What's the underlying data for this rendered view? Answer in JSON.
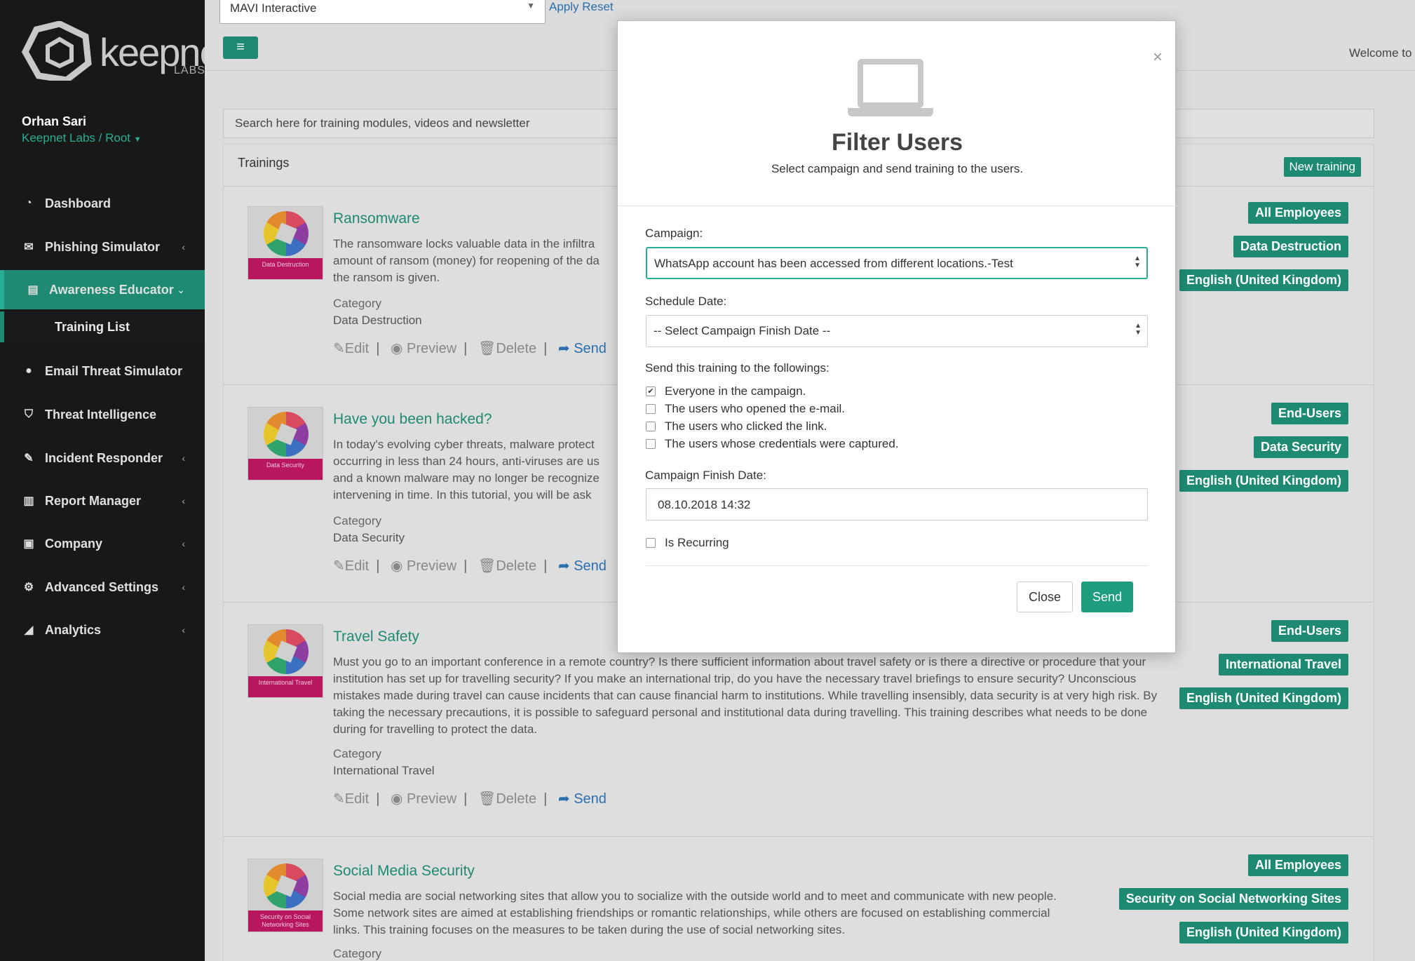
{
  "app": {
    "logo_text": "keepnet",
    "logo_sub": "LABS"
  },
  "topbar": {
    "company_select": "MAVI Interactive",
    "apply_reset": "Apply Reset",
    "welcome": "Welcome to"
  },
  "user": {
    "name": "Orhan Sari",
    "org": "Keepnet Labs / Root"
  },
  "nav": {
    "dashboard": "Dashboard",
    "phishing": "Phishing Simulator",
    "awareness": "Awareness Educator",
    "training_list": "Training List",
    "email_threat": "Email Threat Simulator",
    "threat_intel": "Threat Intelligence",
    "incident": "Incident Responder",
    "report": "Report Manager",
    "company": "Company",
    "advanced": "Advanced Settings",
    "analytics": "Analytics"
  },
  "search": {
    "placeholder": "Search here for training modules, videos and newsletter"
  },
  "trainings": {
    "title": "Trainings",
    "new_training": "New training",
    "category_label": "Category",
    "actions": {
      "edit": "Edit",
      "preview": "Preview",
      "delete": "Delete",
      "send": "Send"
    },
    "items": [
      {
        "title": "Ransomware",
        "thumb": "Data Destruction",
        "desc": "The ransomware locks valuable data in the infiltra\namount of ransom (money) for reopening of the da\nthe ransom is given.",
        "category": "Data Destruction",
        "tags": [
          "All Employees",
          "Data Destruction",
          "English (United Kingdom)"
        ]
      },
      {
        "title": "Have you been hacked?",
        "thumb": "Data Security",
        "desc": "In today's evolving cyber threats, malware protect\noccurring in less than 24 hours, anti-viruses are us\nand a known malware may no longer be recognize\nintervening in time. In this tutorial, you will be ask",
        "category": "Data Security",
        "tags": [
          "End-Users",
          "Data Security",
          "English (United Kingdom)"
        ]
      },
      {
        "title": "Travel Safety",
        "thumb": "International Travel",
        "desc": "Must you go to an important conference in a remote country? Is there sufficient information about travel safety or is there a directive or procedure that your institution has set up for travelling security? If you make an international trip, do you have the necessary travel briefings to ensure security? Unconscious mistakes made during travel can cause incidents that can cause financial harm to institutions. While travelling insensibly, data security is at very high risk. By taking the necessary precautions, it is possible to safeguard personal and institutional data during travelling. This training describes what needs to be done during for travelling to protect the data.",
        "category": "International Travel",
        "tags": [
          "End-Users",
          "International Travel",
          "English (United Kingdom)"
        ]
      },
      {
        "title": "Social Media Security",
        "thumb": "Security on Social Networking Sites",
        "desc": "Social media are social networking sites that allow you to socialize with the outside world and to meet and communicate with new people. Some network sites are aimed at establishing friendships or romantic relationships, while others are focused on establishing commercial links. This training focuses on the measures to be taken during the use of social networking sites.",
        "category": "",
        "tags": [
          "All Employees",
          "Security on Social Networking Sites",
          "English (United Kingdom)"
        ]
      }
    ]
  },
  "modal": {
    "close_x": "×",
    "title": "Filter Users",
    "subtitle": "Select campaign and send training to the users.",
    "campaign_label": "Campaign:",
    "campaign_value": "WhatsApp account has been accessed from different locations.-Test",
    "schedule_label": "Schedule Date:",
    "schedule_value": "-- Select Campaign Finish Date --",
    "send_to_label": "Send this training to the followings:",
    "options": [
      {
        "label": "Everyone in the campaign.",
        "checked": true
      },
      {
        "label": "The users who opened the e-mail.",
        "checked": false
      },
      {
        "label": "The users who clicked the link.",
        "checked": false
      },
      {
        "label": "The users whose credentials were captured.",
        "checked": false
      }
    ],
    "finish_label": "Campaign Finish Date:",
    "finish_value": "08.10.2018 14:32",
    "recurring_label": "Is Recurring",
    "close_btn": "Close",
    "send_btn": "Send"
  }
}
